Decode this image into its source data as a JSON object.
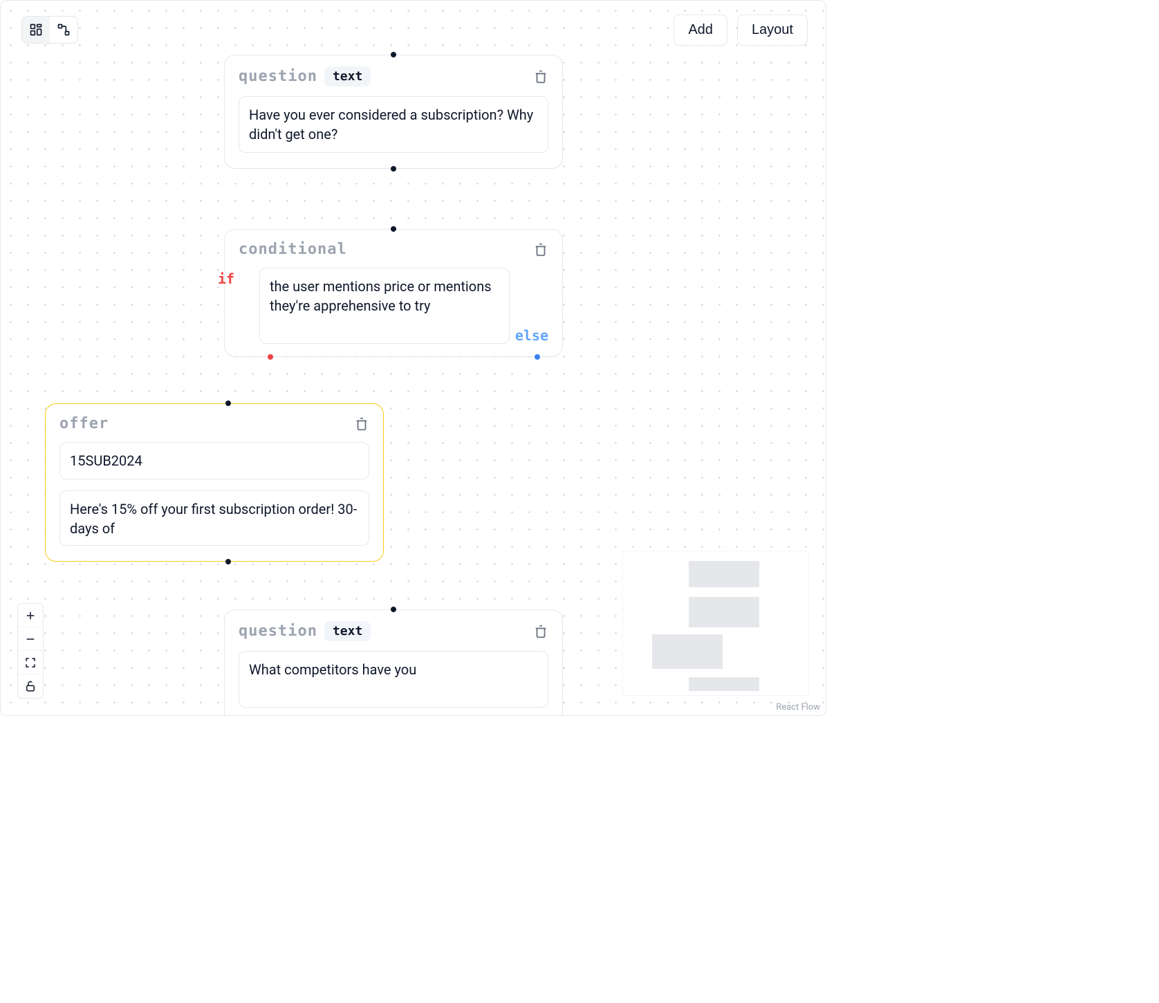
{
  "toolbar": {
    "add_label": "Add",
    "layout_label": "Layout"
  },
  "nodes": {
    "q1": {
      "title": "question",
      "badge": "text",
      "text": "Have you ever considered a subscription? Why didn't get one?"
    },
    "cond": {
      "title": "conditional",
      "if_label": "if",
      "else_label": "else",
      "condition": "the user mentions price or mentions they're apprehensive to try"
    },
    "offer": {
      "title": "offer",
      "code": "15SUB2024",
      "pitch": "Here's 15% off your first subscription order! 30-days of"
    },
    "q2": {
      "title": "question",
      "badge": "text",
      "text": "What competitors have you"
    }
  },
  "attribution": "React Flow"
}
